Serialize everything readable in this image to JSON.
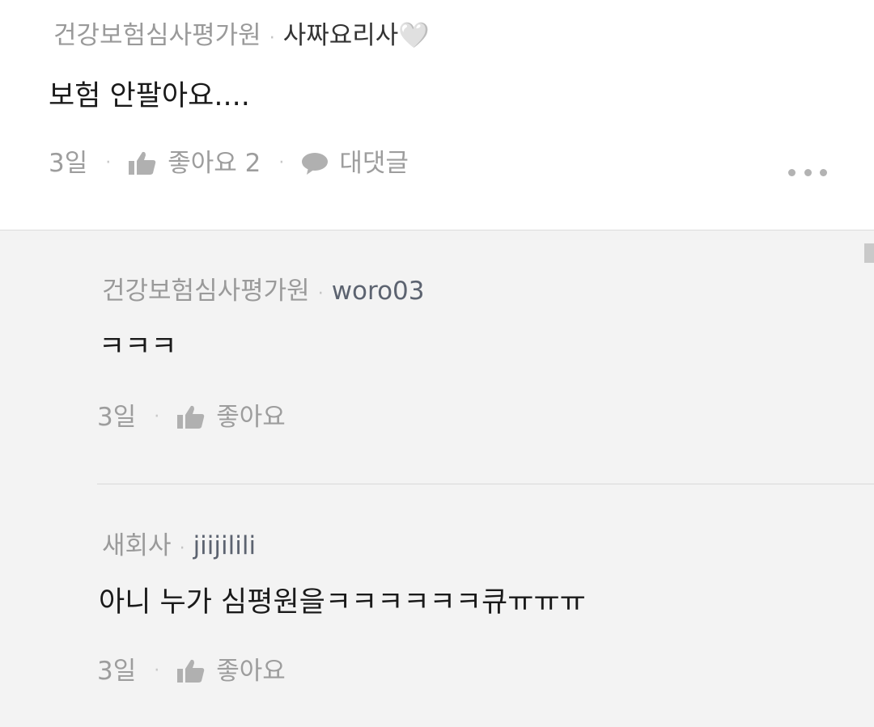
{
  "comment": {
    "company": "건강보험심사평가원",
    "nickname": "사짜요리사🤍",
    "text": "보험 안팔아요....",
    "time": "3일",
    "like_label": "좋아요 2",
    "reply_label": "대댓글"
  },
  "replies": [
    {
      "company": "건강보험심사평가원",
      "nickname": "woro03",
      "text": "ㅋㅋㅋ",
      "time": "3일",
      "like_label": "좋아요"
    },
    {
      "company": "새회사",
      "nickname": "jiijilili",
      "text": "아니 누가 심평원을ㅋㅋㅋㅋㅋㅋ큐ㅠㅠㅠ",
      "time": "3일",
      "like_label": "좋아요"
    }
  ],
  "separator": "·",
  "icons": {
    "like": "thumbs-up-icon",
    "reply": "speech-bubble-icon",
    "more": "more-dots-icon"
  },
  "colors": {
    "reply_background": "#f3f3f3",
    "muted_text": "#9d9d9d",
    "body_text": "#1a1a1a"
  }
}
